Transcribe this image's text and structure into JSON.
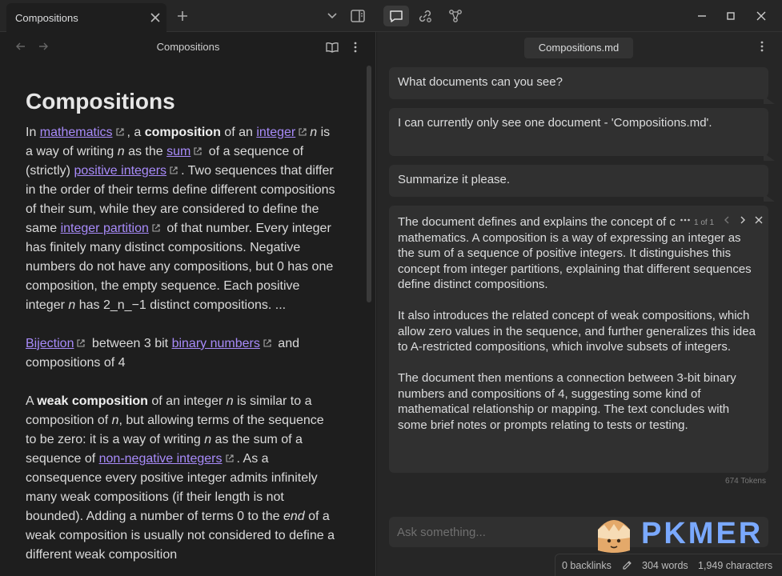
{
  "titlebar": {
    "tab_title": "Compositions"
  },
  "left": {
    "header_title": "Compositions",
    "doc_title": "Compositions",
    "p1": {
      "t1": "In ",
      "l_mathematics": "mathematics",
      "t2": ", a ",
      "b_composition": "composition",
      "t3": " of an ",
      "l_integer": "integer",
      "i_n": "n",
      "t4": " is a way of writing ",
      "i_n2": "n",
      "t5": " as the ",
      "l_sum": "sum",
      "t6": " of a sequence of (strictly) ",
      "l_positive_integers": "positive integers",
      "t7": ". Two sequences that differ in the order of their terms define different compositions of their sum, while they are considered to define the same ",
      "l_integer_partition": "integer partition",
      "t8": " of that number. Every integer has finitely many distinct compositions. Negative numbers do not have any compositions, but 0 has one composition, the empty sequence. Each positive integer ",
      "i_n3": "n",
      "t9": " has 2_n_−1 distinct compositions. ..."
    },
    "p2": {
      "l_bijection": "Bijection",
      "t1": " between 3 bit ",
      "l_binary_numbers": "binary numbers",
      "t2": " and compositions of 4"
    },
    "p3": {
      "t1": "A ",
      "b_weak": "weak composition",
      "t2": " of an integer ",
      "i_n": "n",
      "t3": " is similar to a composition of ",
      "i_n2": "n",
      "t4": ", but allowing terms of the sequence to be zero: it is a way of writing ",
      "i_n3": "n",
      "t5": " as the sum of a sequence of ",
      "l_nonneg": "non-negative integers",
      "t6": ". As a consequence every positive integer admits infinitely many weak compositions (if their length is not bounded). Adding a number of terms 0 to the ",
      "i_end": "end",
      "t7": " of a weak composition is usually not considered to define a different weak composition"
    }
  },
  "right": {
    "tab_title": "Compositions.md",
    "messages": [
      "What documents can you see?",
      "I can currently only see one document - 'Compositions.md'.",
      "Summarize it please."
    ],
    "reply": {
      "counter": "1 of 1",
      "paragraphs": [
        "The document defines and explains the concept of compositions in mathematics. A composition is a way of expressing an integer as the sum of a sequence of positive integers. It distinguishes this concept from integer partitions, explaining that different sequences define distinct compositions.",
        "It also introduces the related concept of weak compositions, which allow zero values in the sequence, and further generalizes this idea to A-restricted compositions, which involve subsets of integers.",
        "The document then mentions a connection between 3-bit binary numbers and compositions of 4, suggesting some kind of mathematical relationship or mapping. The text concludes with some brief notes or prompts relating to tests or testing."
      ]
    },
    "tokens": "674 Tokens",
    "input_placeholder": "Ask something..."
  },
  "statusbar": {
    "backlinks": "0 backlinks",
    "words": "304 words",
    "characters": "1,949 characters"
  },
  "watermark": {
    "text": "PKMER"
  }
}
